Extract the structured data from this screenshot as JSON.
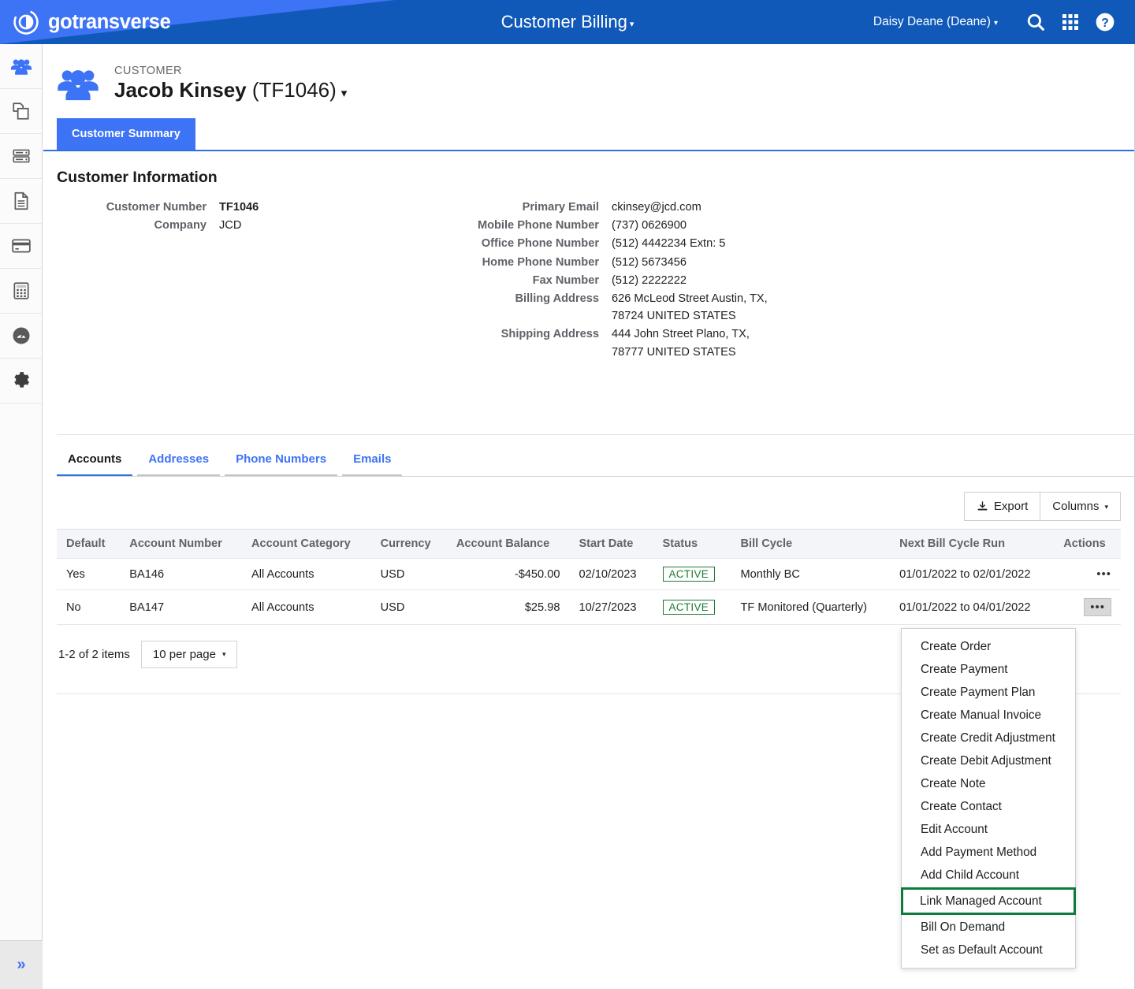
{
  "topbar": {
    "brand": "gotransverse",
    "brand_logo_icon": "circle-arrow-logo",
    "app_title": "Customer Billing",
    "app_title_caret": "▾",
    "user": "Daisy Deane (Deane)",
    "user_caret": "▾",
    "icons": [
      "search-icon",
      "apps-grid-icon",
      "help-circle-icon"
    ],
    "colors": {
      "dark_blue": "#1059b9",
      "light_blue": "#3d73f5"
    }
  },
  "sidebar": {
    "items": [
      {
        "icon": "customers-people-icon",
        "active": true
      },
      {
        "icon": "products-copy-icon",
        "active": false
      },
      {
        "icon": "server-database-icon",
        "active": false
      },
      {
        "icon": "document-icon",
        "active": false
      },
      {
        "icon": "credit-card-icon",
        "active": false
      },
      {
        "icon": "calculator-icon",
        "active": false
      },
      {
        "icon": "dashboard-gauge-icon",
        "active": false
      },
      {
        "icon": "settings-gear-icon",
        "active": false
      }
    ],
    "expand_label": "»"
  },
  "customer": {
    "eyebrow": "CUSTOMER",
    "name": "Jacob Kinsey",
    "number_paren": "(TF1046)",
    "caret": "▾",
    "avatar_icon": "people-group-icon"
  },
  "page_tab": {
    "label": "Customer Summary"
  },
  "info": {
    "title": "Customer Information",
    "left": [
      {
        "label": "Customer Number",
        "value": "TF1046",
        "bold": true
      },
      {
        "label": "Company",
        "value": "JCD",
        "bold": false
      }
    ],
    "right": [
      {
        "label": "Primary Email",
        "value": "ckinsey@jcd.com"
      },
      {
        "label": "Mobile Phone Number",
        "value": "(737) 0626900"
      },
      {
        "label": "Office Phone Number",
        "value": "(512) 4442234 Extn: 5"
      },
      {
        "label": "Home Phone Number",
        "value": "(512) 5673456"
      },
      {
        "label": "Fax Number",
        "value": "(512) 2222222"
      },
      {
        "label": "Billing Address",
        "value": "626 McLeod Street Austin, TX, 78724 UNITED STATES"
      },
      {
        "label": "Shipping Address",
        "value": "444 John Street Plano, TX, 78777 UNITED STATES"
      }
    ]
  },
  "subtabs": [
    {
      "label": "Accounts",
      "active": true
    },
    {
      "label": "Addresses",
      "active": false
    },
    {
      "label": "Phone Numbers",
      "active": false
    },
    {
      "label": "Emails",
      "active": false
    }
  ],
  "toolbar": {
    "export_label": "Export",
    "export_icon": "download-icon",
    "columns_label": "Columns",
    "columns_caret": "▾"
  },
  "table": {
    "columns": [
      "Default",
      "Account Number",
      "Account Category",
      "Currency",
      "Account Balance",
      "Start Date",
      "Status",
      "Bill Cycle",
      "Next Bill Cycle Run",
      "Actions"
    ],
    "rows": [
      {
        "default": "Yes",
        "account_number": "BA146",
        "account_category": "All Accounts",
        "currency": "USD",
        "account_balance": "-$450.00",
        "start_date": "02/10/2023",
        "status": "ACTIVE",
        "bill_cycle": "Monthly BC",
        "next_bill_cycle_run": "01/01/2022 to 02/01/2022",
        "actions": "•••"
      },
      {
        "default": "No",
        "account_number": "BA147",
        "account_category": "All Accounts",
        "currency": "USD",
        "account_balance": "$25.98",
        "start_date": "10/27/2023",
        "status": "ACTIVE",
        "bill_cycle": "TF Monitored (Quarterly)",
        "next_bill_cycle_run": "01/01/2022 to 04/01/2022",
        "actions": "•••"
      }
    ]
  },
  "pager": {
    "items_text": "1-2 of 2 items",
    "per_page": "10 per page",
    "caret": "▾"
  },
  "actions_menu": {
    "items": [
      {
        "label": "Create Order",
        "highlight": false
      },
      {
        "label": "Create Payment",
        "highlight": false
      },
      {
        "label": "Create Payment Plan",
        "highlight": false
      },
      {
        "label": "Create Manual Invoice",
        "highlight": false
      },
      {
        "label": "Create Credit Adjustment",
        "highlight": false
      },
      {
        "label": "Create Debit Adjustment",
        "highlight": false
      },
      {
        "label": "Create Note",
        "highlight": false
      },
      {
        "label": "Create Contact",
        "highlight": false
      },
      {
        "label": "Edit Account",
        "highlight": false
      },
      {
        "label": "Add Payment Method",
        "highlight": false
      },
      {
        "label": "Add Child Account",
        "highlight": false
      },
      {
        "label": "Link Managed Account",
        "highlight": true
      },
      {
        "label": "Bill On Demand",
        "highlight": false
      },
      {
        "label": "Set as Default Account",
        "highlight": false
      }
    ],
    "highlight_color": "#0f7a3d"
  }
}
